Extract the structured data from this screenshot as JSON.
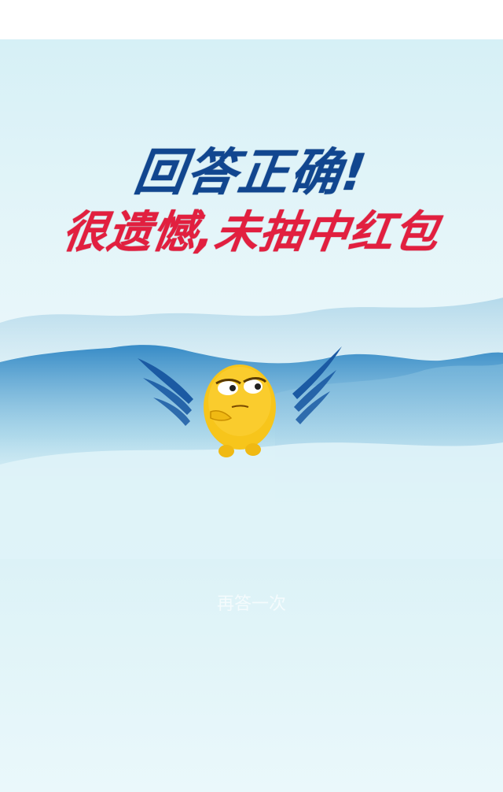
{
  "result": {
    "headline": "回答正确!",
    "subline": "很遗憾,未抽中红包"
  },
  "actions": {
    "retry_label": "再答一次"
  },
  "mascot": {
    "icon": "winged-thinking-character-icon"
  },
  "colors": {
    "headline": "#11468f",
    "subline": "#e21f3f",
    "mascot_body": "#f7c51b",
    "wings": "#1b5aa3"
  }
}
